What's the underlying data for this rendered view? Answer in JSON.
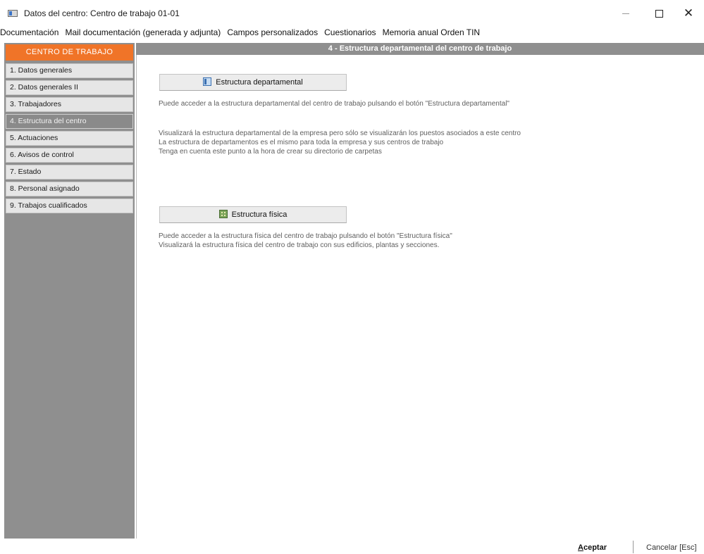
{
  "window": {
    "title": "Datos del centro: Centro de trabajo 01-01",
    "controls": [
      "minimize",
      "maximize",
      "close"
    ],
    "close_glyph": "✕"
  },
  "menu": [
    "Documentación",
    "Mail documentación (generada y adjunta)",
    "Campos personalizados",
    "Cuestionarios",
    "Memoria anual Orden TIN"
  ],
  "sidebar": {
    "header": "CENTRO DE TRABAJO",
    "items": [
      "1. Datos generales",
      "2. Datos generales II",
      "3. Trabajadores",
      "4. Estructura del centro",
      "5. Actuaciones",
      "6. Avisos de control",
      "7. Estado",
      "8. Personal asignado",
      "9. Trabajos cualificados"
    ],
    "active_index": 3
  },
  "main": {
    "header": "4 - Estructura departamental del centro de trabajo",
    "dept_button": {
      "label": "Estructura departamental",
      "icon": "org-structure-icon"
    },
    "dept_lines": [
      "Puede acceder a la estructura departamental del centro de trabajo pulsando el botón \"Estructura departamental\"",
      "Visualizará la estructura departamental de la empresa pero sólo se visualizarán los puestos asociados a este centro",
      "La estructura de departamentos es el mismo para toda la empresa y sus centros de trabajo",
      "Tenga en cuenta este punto a la hora de crear su directorio de carpetas"
    ],
    "phys_button": {
      "label": "Estructura física",
      "icon": "building-icon"
    },
    "phys_lines": [
      "Puede acceder a la estructura física del centro de trabajo pulsando el botón \"Estructura física\"",
      "Visualizará la estructura física del centro de trabajo con sus edificios, plantas y secciones."
    ]
  },
  "footer": {
    "accept_mnemonic": "A",
    "accept_rest": "ceptar",
    "cancel": "Cancelar [Esc]"
  },
  "colors": {
    "sidebar_header": "#f07428",
    "sidebar_bg": "#8f8f8f",
    "header_bar": "#8f8f8f"
  }
}
